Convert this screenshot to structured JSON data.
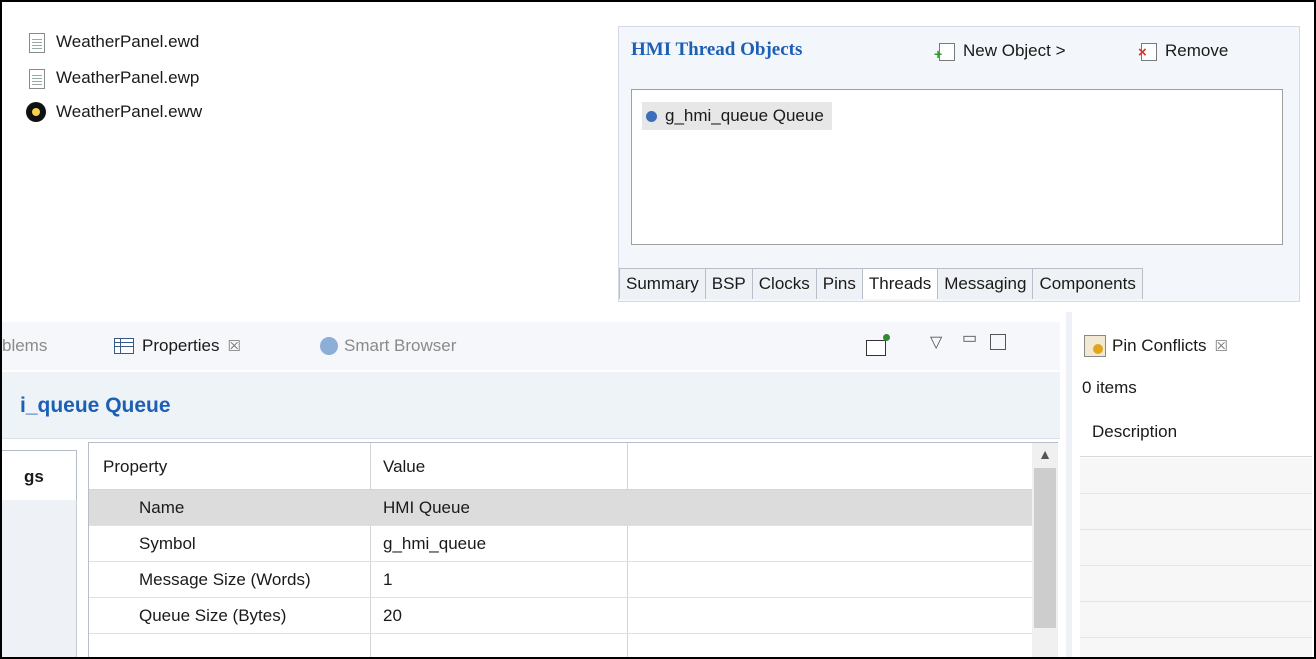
{
  "files": [
    {
      "name": "WeatherPanel.ewd",
      "icon": "document-icon"
    },
    {
      "name": "WeatherPanel.ewp",
      "icon": "document-icon"
    },
    {
      "name": "WeatherPanel.eww",
      "icon": "workspace-icon"
    }
  ],
  "thread_objects": {
    "title": "HMI Thread Objects",
    "new_object_label": "New Object >",
    "remove_label": "Remove",
    "items": [
      {
        "label": "g_hmi_queue Queue"
      }
    ],
    "tabs": [
      "Summary",
      "BSP",
      "Clocks",
      "Pins",
      "Threads",
      "Messaging",
      "Components"
    ],
    "active_tab": "Threads"
  },
  "properties_view": {
    "tabs": [
      {
        "label": "blems",
        "close": ""
      },
      {
        "label": "Properties",
        "close": "☒"
      },
      {
        "label": "Smart Browser",
        "close": ""
      }
    ],
    "title": "i_queue Queue",
    "side_tab": "gs",
    "columns": [
      "Property",
      "Value"
    ],
    "rows": [
      {
        "property": "Name",
        "value": "HMI Queue",
        "selected": true
      },
      {
        "property": "Symbol",
        "value": "g_hmi_queue"
      },
      {
        "property": "Message Size (Words)",
        "value": "1"
      },
      {
        "property": "Queue Size (Bytes)",
        "value": "20"
      }
    ]
  },
  "pin_conflicts": {
    "tab_label": "Pin Conflicts",
    "close": "☒",
    "count": "0 items",
    "column": "Description"
  },
  "colors": {
    "accent": "#1c5fb5",
    "selection": "#dcdcdc"
  }
}
